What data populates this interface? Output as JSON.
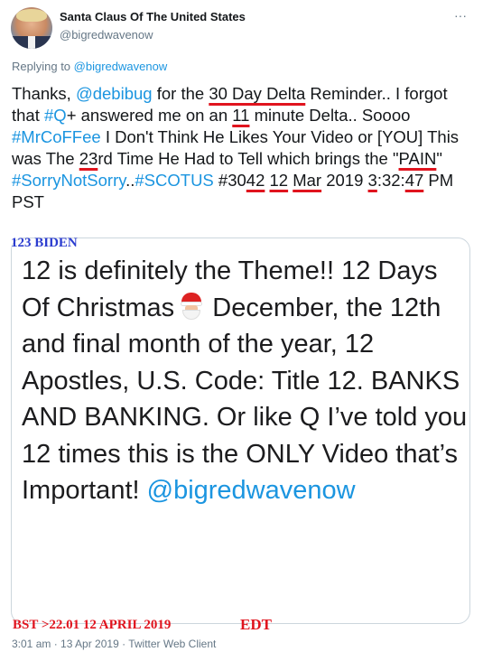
{
  "author": {
    "display_name": "Santa Claus Of The United States",
    "handle": "@bigredwavenow",
    "avatar_icon": "profile-photo"
  },
  "more_icon": "···",
  "reply": {
    "prefix": "Replying to",
    "mention": "@bigredwavenow"
  },
  "tweet": {
    "s1": "Thanks, ",
    "m1": "@debibug",
    "s2": " for the ",
    "u1": "30 Day Delta",
    "s3": " Reminder.. I forgot that ",
    "h1": "#Q",
    "s4": "+ answered me on an ",
    "u2": "11",
    "s5": " minute Delta.. Soooo ",
    "h2": "#MrCoFFee",
    "s6": " I Don't Think He Likes Your Video or [YOU] This was The ",
    "u3": "23",
    "s7": "rd Time He Had to Tell which brings the \"",
    "u4": "PAIN",
    "s8": "\" ",
    "h3": "#SorryNotSorry",
    "s9": "..",
    "h4": "#SCOTUS",
    "s10": " #30",
    "u5": "42",
    "s11": " ",
    "u6": "12",
    "s12": " ",
    "u7": "Mar",
    "s13": " 2019 ",
    "u8": "3",
    "s14": ":32:",
    "u9": "47",
    "s15": " PM PST"
  },
  "annotations": {
    "biden": "123 BIDEN",
    "bst": "BST >22.01 12 APRIL 2019",
    "edt": "EDT"
  },
  "card": {
    "t1": "12 is definitely the Theme!! 12 Days Of Christmas",
    "emoji_icon": "santa-emoji",
    "t2": " December, the 12th and final month of the year, 12 Apostles, U.S. Code: Title 12. BANKS AND BANKING. Or like Q I’ve told you 12 times this is the ONLY Video that’s Important! ",
    "mention": "@bigredwavenow"
  },
  "meta": {
    "timestamp": "3:01 am · 13 Apr 2019 · Twitter Web Client"
  }
}
